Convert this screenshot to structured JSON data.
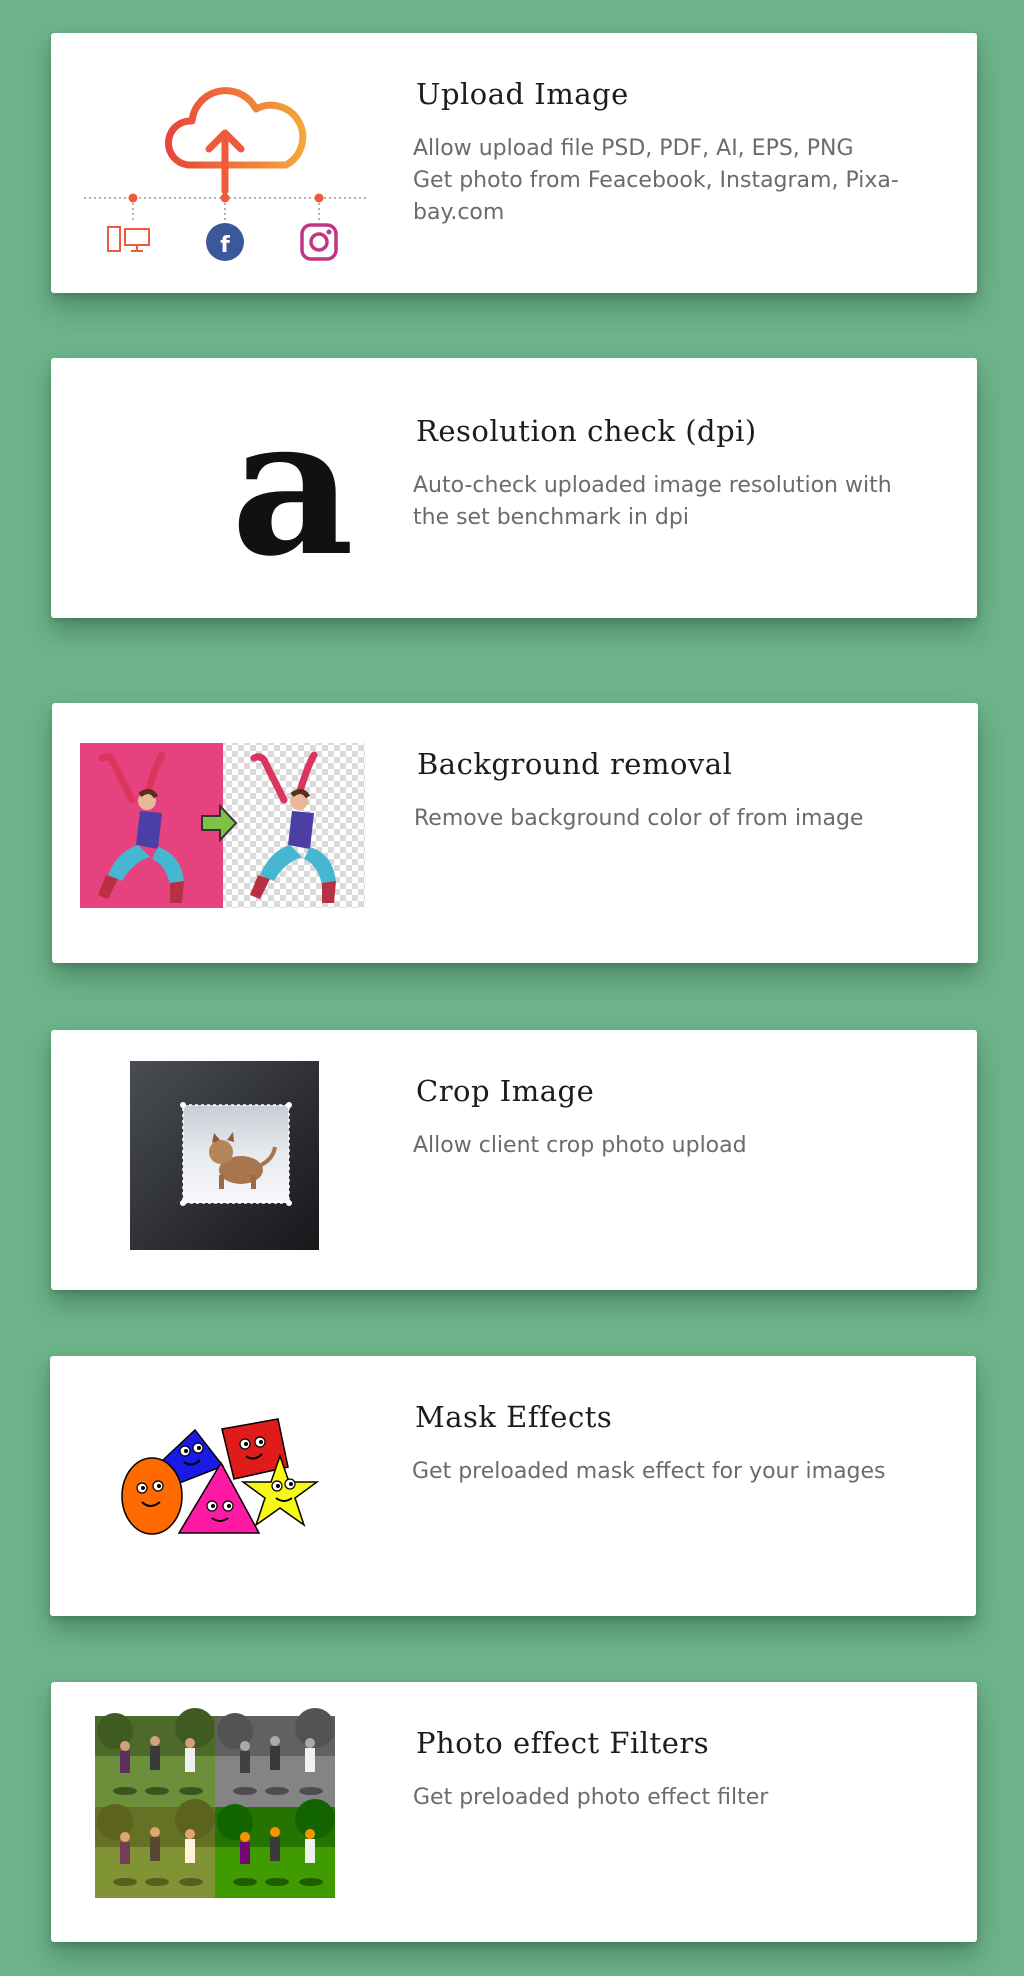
{
  "features": [
    {
      "title": "Upload Image",
      "description": [
        "Allow upload file PSD, PDF, AI, EPS, PNG",
        "Get photo from Feacebook, Instagram, Pixa-",
        "bay.com"
      ],
      "icon": "cloud-upload-icon"
    },
    {
      "title": "Resolution check (dpi)",
      "description": [
        "Auto-check uploaded image resolution with",
        "the set benchmark in dpi"
      ],
      "icon": "resolution-comparison-icon",
      "glyph": "a"
    },
    {
      "title": "Background removal",
      "description": [
        "Remove background color of from image"
      ],
      "icon": "background-removal-illustration"
    },
    {
      "title": "Crop Image",
      "description": [
        "Allow client crop photo upload"
      ],
      "icon": "crop-image-illustration"
    },
    {
      "title": "Mask Effects",
      "description": [
        "Get preloaded mask effect for your images"
      ],
      "icon": "mask-shapes-illustration"
    },
    {
      "title": "Photo effect Filters",
      "description": [
        "Get preloaded photo effect filter"
      ],
      "icon": "photo-filters-illustration"
    }
  ],
  "colors": {
    "background": "#6db48a",
    "card": "#ffffff",
    "accent_orange": "#ee5a3a",
    "facebook": "#3b5998",
    "instagram": "#c13584"
  }
}
